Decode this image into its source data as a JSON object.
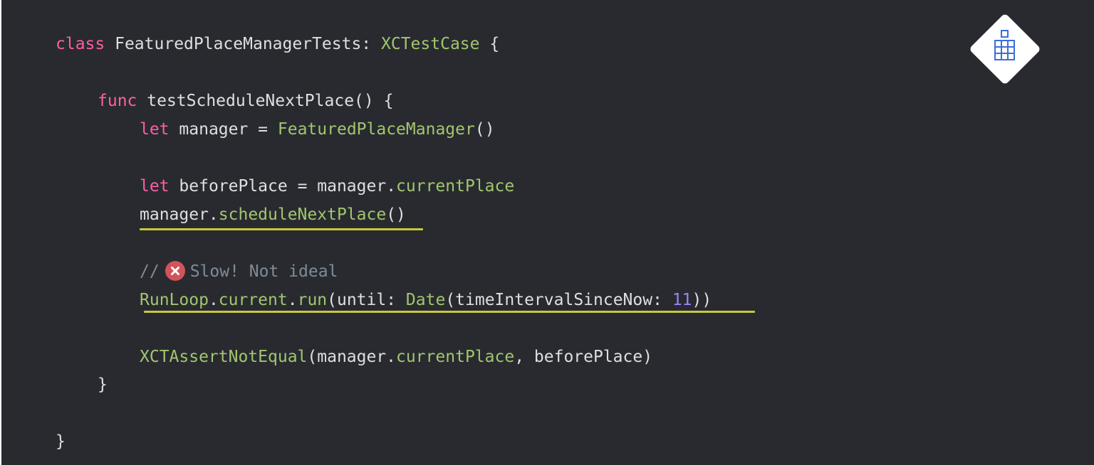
{
  "code": {
    "line1": {
      "kw": "class",
      "name": "FeaturedPlaceManagerTests",
      "colon": ":",
      "super": "XCTestCase",
      "brace": "{"
    },
    "line2": {
      "kw": "func",
      "name": "testScheduleNextPlace() {"
    },
    "line3": {
      "kw": "let",
      "var": "manager =",
      "call": "FeaturedPlaceManager",
      "parens": "()"
    },
    "line4": {
      "kw": "let",
      "var": "beforePlace = manager.",
      "prop": "currentPlace"
    },
    "line5": {
      "obj": "manager.",
      "method": "scheduleNextPlace",
      "parens": "()"
    },
    "line6": {
      "slashes": "//",
      "text": "Slow! Not ideal"
    },
    "line7": {
      "runloop": "RunLoop",
      "dot1": ".",
      "current": "current",
      "dot2": ".",
      "run": "run",
      "until": "(until: ",
      "date": "Date",
      "arg": "(timeIntervalSinceNow: ",
      "num": "11",
      "close": "))"
    },
    "line8": {
      "assert": "XCTAssertNotEqual",
      "open": "(manager.",
      "prop": "currentPlace",
      "rest": ", beforePlace)"
    },
    "line9": {
      "brace": "}"
    },
    "line10": {
      "brace": "}"
    }
  },
  "badge": {
    "icon": "error-x-icon",
    "color": "#d0545a"
  },
  "logo": {
    "icon": "building-icon",
    "color": "#3b6fd8"
  },
  "colors": {
    "background": "#292a30",
    "keyword": "#fc5fa3",
    "type": "#a1c66d",
    "number": "#9686f5",
    "comment": "#7f8c98",
    "plain": "#dfdfe0",
    "underline": "#c8c93a"
  }
}
